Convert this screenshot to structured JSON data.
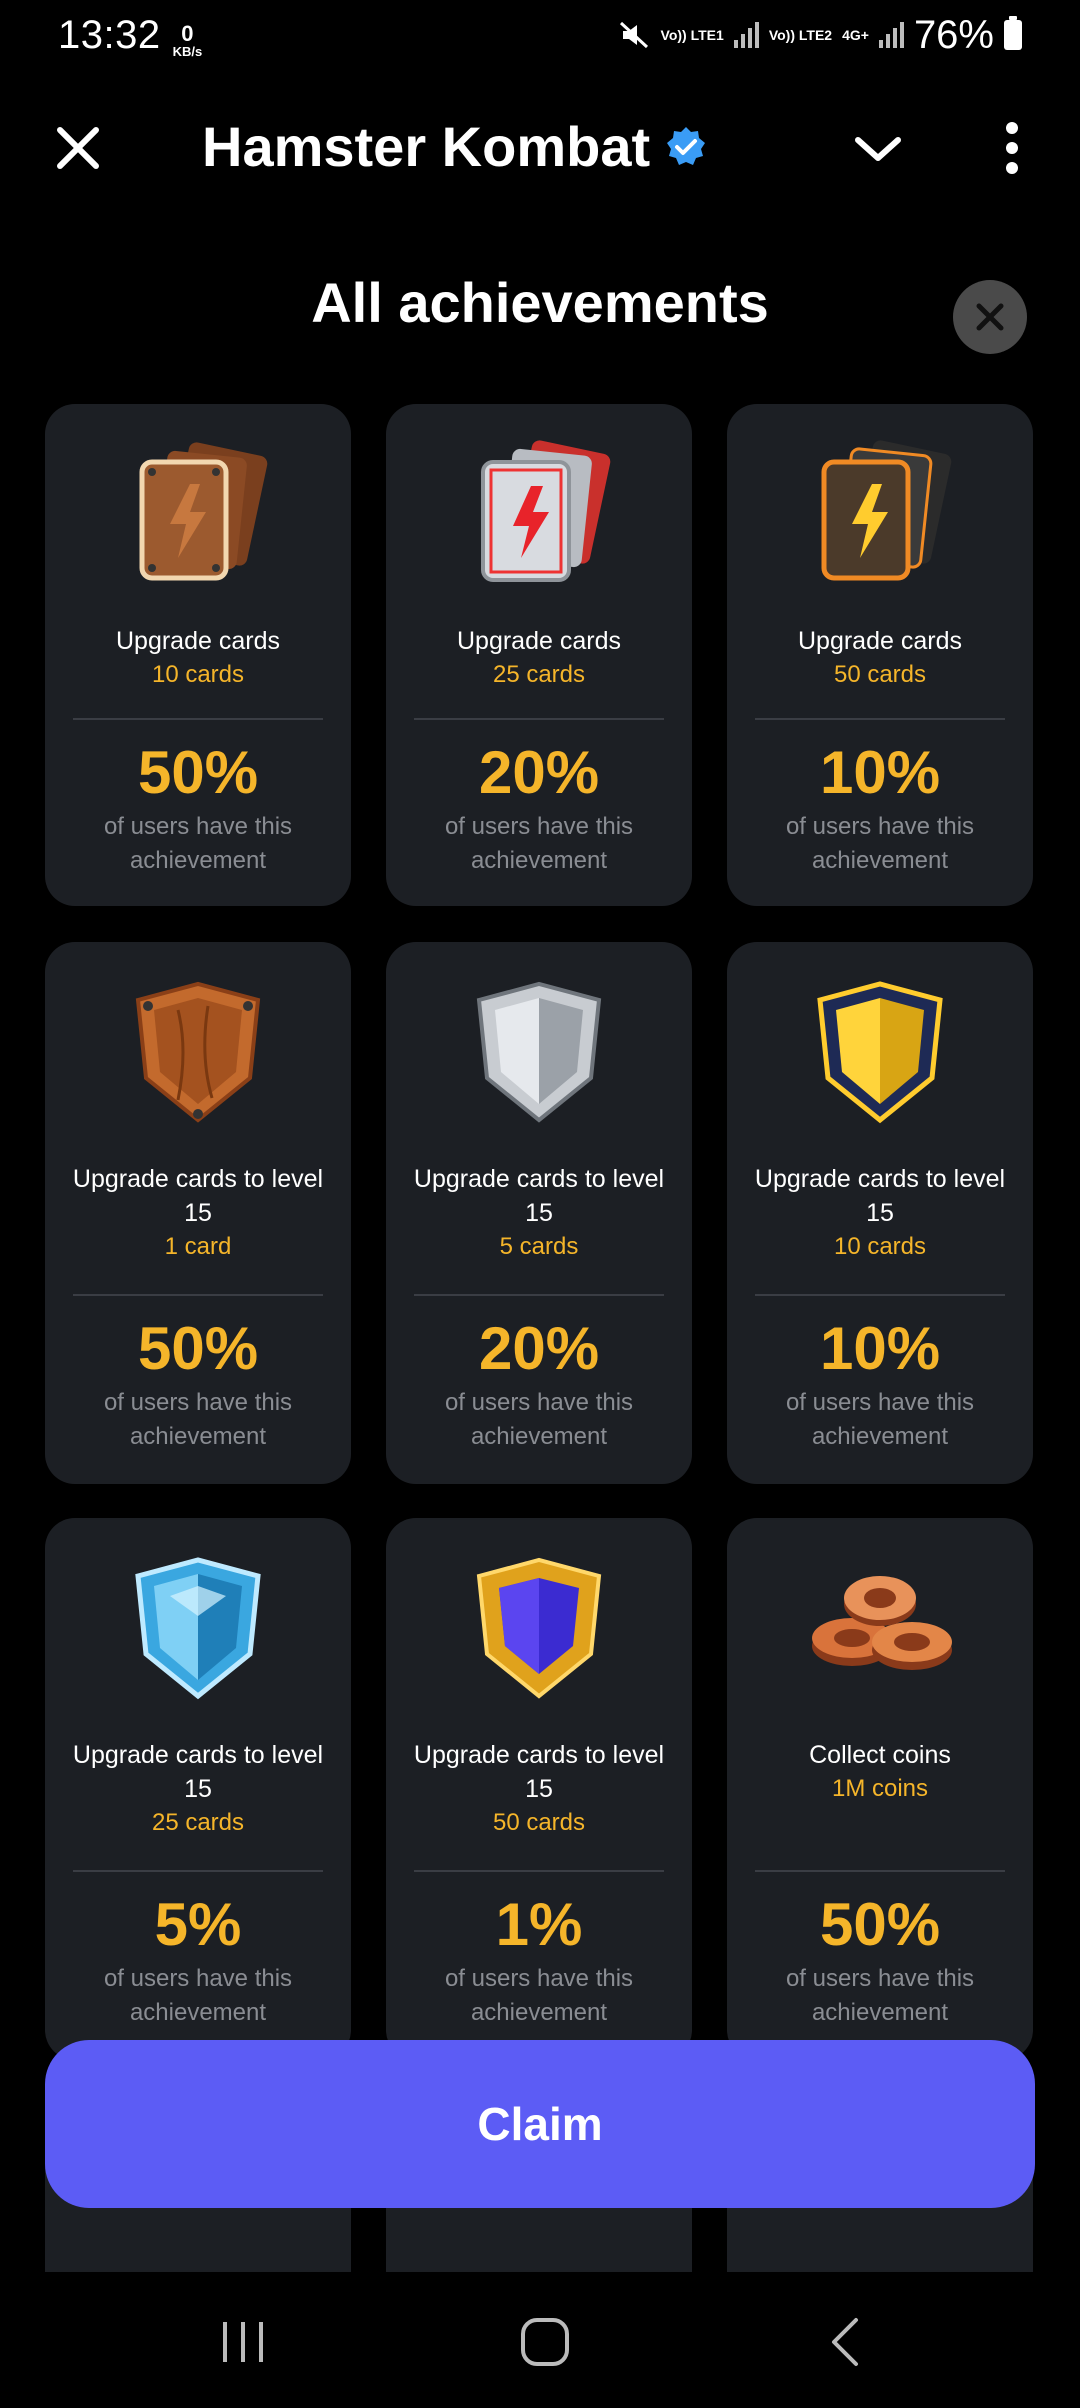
{
  "status_bar": {
    "time": "13:32",
    "net_speed": "0",
    "net_unit": "KB/s",
    "sim1": "Vo)) LTE1",
    "sim2": "Vo)) LTE2",
    "sim2_tech": "4G+",
    "battery": "76%"
  },
  "header": {
    "app_title": "Hamster Kombat",
    "verified_icon": "verified-badge-icon",
    "close_icon": "close-icon",
    "chevron_icon": "chevron-down-icon",
    "menu_icon": "more-vertical-icon"
  },
  "sheet": {
    "title": "All achievements",
    "close_icon": "close-circle-icon"
  },
  "achievements": [
    {
      "title": "Upgrade cards",
      "sub": "10 cards",
      "percent": "50%",
      "desc": "of users have this achievement",
      "icon": "wood-cards-icon"
    },
    {
      "title": "Upgrade cards",
      "sub": "25 cards",
      "percent": "20%",
      "desc": "of users have this achievement",
      "icon": "silver-cards-icon"
    },
    {
      "title": "Upgrade cards",
      "sub": "50 cards",
      "percent": "10%",
      "desc": "of users have this achievement",
      "icon": "gold-cards-icon"
    },
    {
      "title": "Upgrade cards to level 15",
      "sub": "1 card",
      "percent": "50%",
      "desc": "of users have this achievement",
      "icon": "wood-shield-icon"
    },
    {
      "title": "Upgrade cards to level 15",
      "sub": "5 cards",
      "percent": "20%",
      "desc": "of users have this achievement",
      "icon": "silver-shield-icon"
    },
    {
      "title": "Upgrade cards to level 15",
      "sub": "10 cards",
      "percent": "10%",
      "desc": "of users have this achievement",
      "icon": "gold-shield-icon"
    },
    {
      "title": "Upgrade cards to level 15",
      "sub": "25 cards",
      "percent": "5%",
      "desc": "of users have this achievement",
      "icon": "diamond-shield-icon"
    },
    {
      "title": "Upgrade cards to level 15",
      "sub": "50 cards",
      "percent": "1%",
      "desc": "of users have this achievement",
      "icon": "sapphire-shield-icon"
    },
    {
      "title": "Collect coins",
      "sub": "1M coins",
      "percent": "50%",
      "desc": "of users have this achievement",
      "icon": "bronze-coins-icon"
    }
  ],
  "partial_row_icons": [
    "silver-coins-icon",
    "gold-coins-icon",
    "wood-badge-icon"
  ],
  "claim_label": "Claim",
  "nav": {
    "recents_icon": "recents-icon",
    "home_icon": "home-icon",
    "back_icon": "back-icon"
  },
  "colors": {
    "accent_yellow": "#f5b52a",
    "claim_button": "#5c5cf5",
    "card_bg": "#1c1f24",
    "verified_blue": "#3a9cf5"
  }
}
